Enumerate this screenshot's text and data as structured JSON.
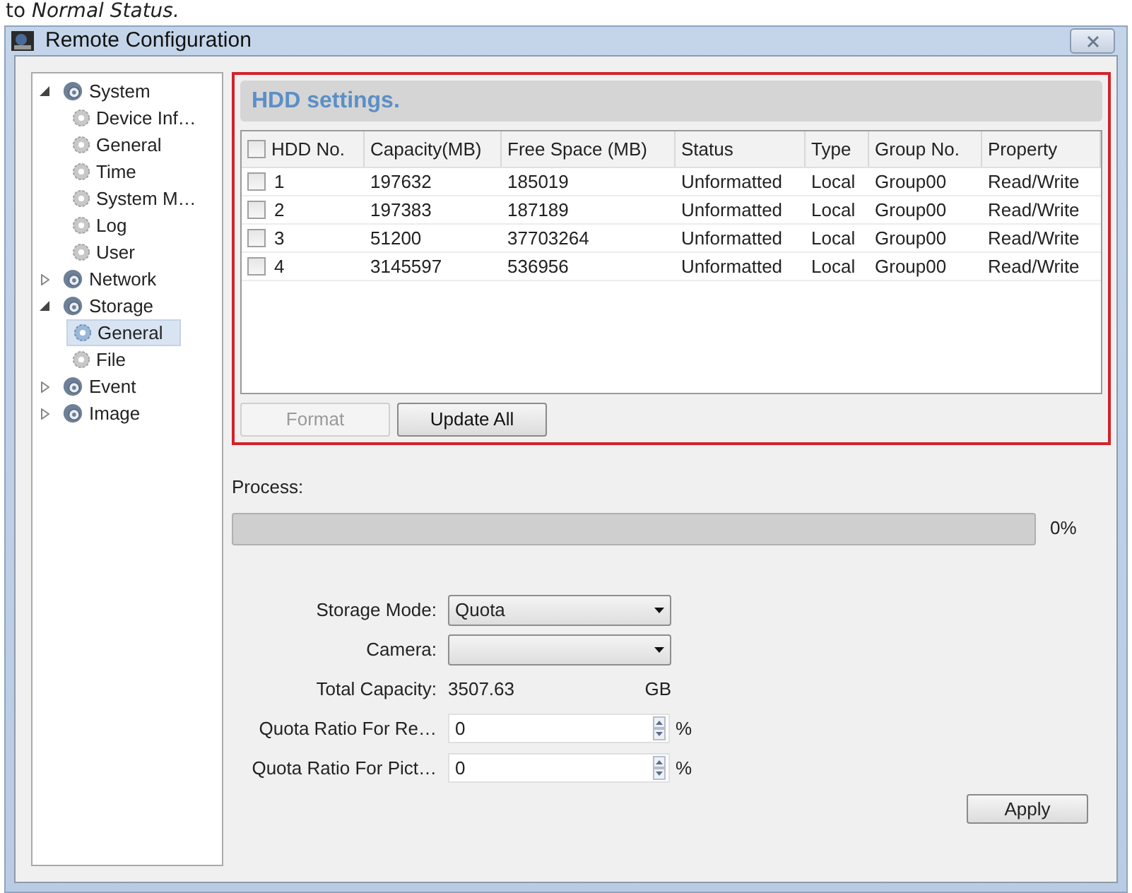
{
  "caption": "to *Normal Status.*",
  "window": {
    "title": "Remote Configuration"
  },
  "sidebar": {
    "items": [
      {
        "label": "System",
        "expanded": true,
        "selected": false,
        "children": [
          {
            "label": "Device Inf…",
            "selected": false
          },
          {
            "label": "General",
            "selected": false
          },
          {
            "label": "Time",
            "selected": false
          },
          {
            "label": "System M…",
            "selected": false
          },
          {
            "label": "Log",
            "selected": false
          },
          {
            "label": "User",
            "selected": false
          }
        ]
      },
      {
        "label": "Network",
        "expanded": false,
        "selected": false
      },
      {
        "label": "Storage",
        "expanded": true,
        "selected": false,
        "children": [
          {
            "label": "General",
            "selected": true
          },
          {
            "label": "File",
            "selected": false
          }
        ]
      },
      {
        "label": "Event",
        "expanded": false,
        "selected": false
      },
      {
        "label": "Image",
        "expanded": false,
        "selected": false
      }
    ]
  },
  "hdd_settings": {
    "title": "HDD settings.",
    "select_all_checked": false,
    "table": {
      "columns": [
        "HDD No.",
        "Capacity(MB)",
        "Free Space (MB)",
        "Status",
        "Type",
        "Group No.",
        "Property"
      ],
      "rows": [
        {
          "checked": false,
          "cells": [
            "1",
            "197632",
            "185019",
            "Unformatted",
            "Local",
            "Group00",
            "Read/Write"
          ]
        },
        {
          "checked": false,
          "cells": [
            "2",
            "197383",
            "187189",
            "Unformatted",
            "Local",
            "Group00",
            "Read/Write"
          ]
        },
        {
          "checked": false,
          "cells": [
            "3",
            "51200",
            "37703264",
            "Unformatted",
            "Local",
            "Group00",
            "Read/Write"
          ]
        },
        {
          "checked": false,
          "cells": [
            "4",
            "3145597",
            "536956",
            "Unformatted",
            "Local",
            "Group00",
            "Read/Write"
          ]
        }
      ]
    },
    "buttons": [
      {
        "label": "Format",
        "disabled": true
      },
      {
        "label": "Update All",
        "disabled": false
      }
    ]
  },
  "process": {
    "label": "Process:",
    "level": 0,
    "reading": "0%"
  },
  "form": [
    {
      "kind": "select",
      "label": "Storage Mode:",
      "value": "Quota"
    },
    {
      "kind": "select",
      "label": "Camera:"
    },
    {
      "kind": "text",
      "label": "Total Capacity:",
      "value": "3507.63",
      "unit": "GB"
    },
    {
      "kind": "spin",
      "label": "Quota Ratio For Re…",
      "value": "0",
      "unit": "%"
    },
    {
      "kind": "spin",
      "label": "Quota Ratio For Pict…",
      "value": "0",
      "unit": "%"
    }
  ],
  "apply_button": "Apply"
}
